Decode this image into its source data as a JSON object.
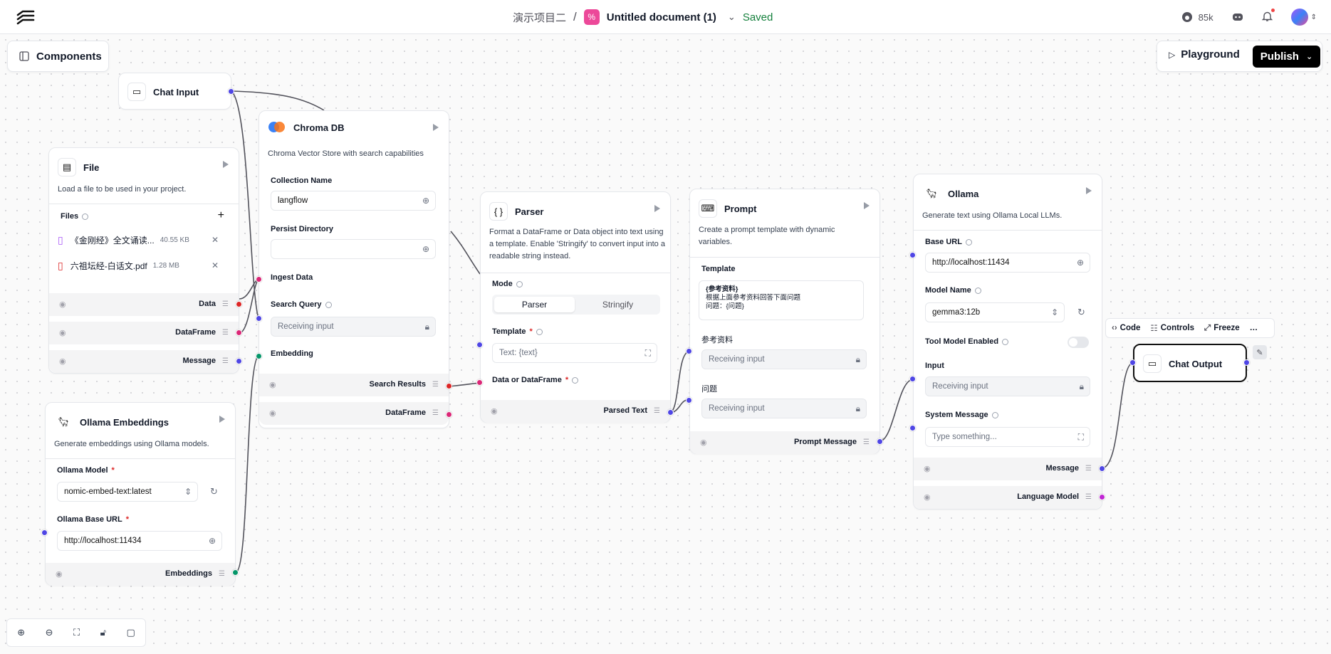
{
  "header": {
    "project": "演示项目二",
    "separator": "/",
    "doc_title": "Untitled document (1)",
    "status": "Saved",
    "github_stars": "85k"
  },
  "toolbar": {
    "components_label": "Components",
    "playground_label": "Playground",
    "publish_label": "Publish"
  },
  "nodes": {
    "chat_input": {
      "title": "Chat Input"
    },
    "file": {
      "title": "File",
      "desc": "Load a file to be used in your project.",
      "files_label": "Files",
      "files": [
        {
          "name": "《金刚经》全文诵读...",
          "size": "40.55 KB"
        },
        {
          "name": "六祖坛经-白话文.pdf",
          "size": "1.28 MB"
        }
      ],
      "outputs": [
        "Data",
        "DataFrame",
        "Message"
      ]
    },
    "chroma": {
      "title": "Chroma DB",
      "desc": "Chroma Vector Store with search capabilities",
      "collection_label": "Collection Name",
      "collection_value": "langflow",
      "persist_label": "Persist Directory",
      "ingest_label": "Ingest Data",
      "search_label": "Search Query",
      "search_placeholder": "Receiving input",
      "embedding_label": "Embedding",
      "outputs": [
        "Search Results",
        "DataFrame"
      ]
    },
    "parser": {
      "title": "Parser",
      "desc": "Format a DataFrame or Data object into text using a template. Enable 'Stringify' to convert input into a readable string instead.",
      "mode_label": "Mode",
      "mode_on": "Parser",
      "mode_off": "Stringify",
      "template_label": "Template",
      "template_placeholder": "Text: {text}",
      "data_label": "Data or DataFrame",
      "output": "Parsed Text"
    },
    "prompt": {
      "title": "Prompt",
      "desc": "Create a prompt template with dynamic variables.",
      "template_label": "Template",
      "template_lines": [
        "{参考资料}",
        "根据上面参考资料回答下面问题",
        "问题：{问题}"
      ],
      "ref_label": "参考资料",
      "ref_placeholder": "Receiving input",
      "q_label": "问题",
      "q_placeholder": "Receiving input",
      "output": "Prompt Message"
    },
    "ollama": {
      "title": "Ollama",
      "desc": "Generate text using Ollama Local LLMs.",
      "base_url_label": "Base URL",
      "base_url_value": "http://localhost:11434",
      "model_label": "Model Name",
      "model_value": "gemma3:12b",
      "tool_label": "Tool Model Enabled",
      "input_label": "Input",
      "input_placeholder": "Receiving input",
      "system_label": "System Message",
      "system_placeholder": "Type something...",
      "outputs": [
        "Message",
        "Language Model"
      ]
    },
    "ollama_embeddings": {
      "title": "Ollama Embeddings",
      "desc": "Generate embeddings using Ollama models.",
      "model_label": "Ollama Model",
      "model_value": "nomic-embed-text:latest",
      "base_url_label": "Ollama Base URL",
      "base_url_value": "http://localhost:11434",
      "output": "Embeddings"
    },
    "chat_output": {
      "title": "Chat Output"
    }
  },
  "node_toolbar": {
    "code": "Code",
    "controls": "Controls",
    "freeze": "Freeze",
    "more": "…"
  },
  "colors": {
    "accent": "#000000",
    "doc_icon": "#ec4899",
    "saved": "#15803d"
  }
}
